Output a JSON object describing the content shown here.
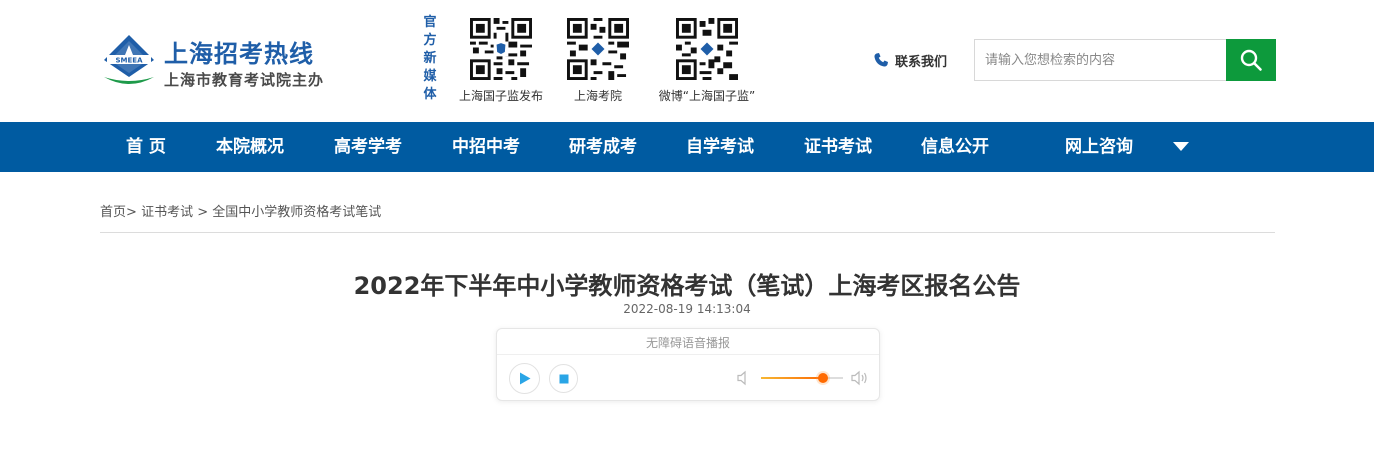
{
  "header": {
    "logo_badge": "SMEEA",
    "logo_title": "上海招考热线",
    "logo_subtitle": "上海市教育考试院主办",
    "media_label": "官方新媒体",
    "qr_codes": [
      {
        "caption": "上海国子监发布"
      },
      {
        "caption": "上海考院"
      },
      {
        "caption": "微博“上海国子监”"
      }
    ],
    "contact_label": "联系我们",
    "search": {
      "placeholder": "请输入您想检索的内容",
      "value": ""
    }
  },
  "nav": {
    "items": [
      {
        "label": "首 页"
      },
      {
        "label": "本院概况"
      },
      {
        "label": "高考学考"
      },
      {
        "label": "中招中考"
      },
      {
        "label": "研考成考"
      },
      {
        "label": "自学考试"
      },
      {
        "label": "证书考试"
      },
      {
        "label": "信息公开"
      },
      {
        "label": "网上咨询"
      }
    ]
  },
  "breadcrumb": {
    "items": [
      "首页",
      "证书考试",
      "全国中小学教师资格考试笔试"
    ],
    "separator": ">"
  },
  "article": {
    "title": "2022年下半年中小学教师资格考试（笔试）上海考区报名公告",
    "date": "2022-08-19 14:13:04"
  },
  "player": {
    "title": "无障碍语音播报",
    "volume": 0.75
  },
  "colors": {
    "brand_blue": "#005ba1",
    "search_green": "#0d9a3c",
    "volume_orange": "#ff6a00",
    "player_accent": "#2aa5e6"
  }
}
